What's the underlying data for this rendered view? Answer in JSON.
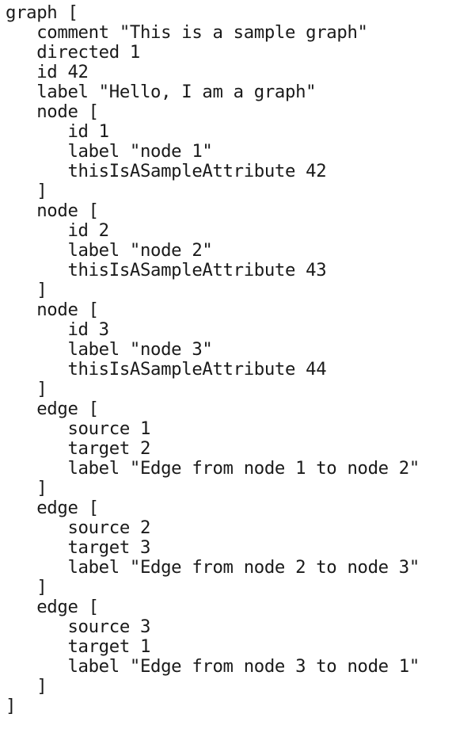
{
  "document": {
    "kind": "plain-text-code-listing",
    "language": "GML",
    "background_color": "#ffffff",
    "text_color": "#1a1a1a",
    "indent_unit": "   ",
    "line_count": 35
  },
  "listing": {
    "lines": [
      "graph [",
      "   comment \"This is a sample graph\"",
      "   directed 1",
      "   id 42",
      "   label \"Hello, I am a graph\"",
      "   node [",
      "      id 1",
      "      label \"node 1\"",
      "      thisIsASampleAttribute 42",
      "   ]",
      "   node [",
      "      id 2",
      "      label \"node 2\"",
      "      thisIsASampleAttribute 43",
      "   ]",
      "   node [",
      "      id 3",
      "      label \"node 3\"",
      "      thisIsASampleAttribute 44",
      "   ]",
      "   edge [",
      "      source 1",
      "      target 2",
      "      label \"Edge from node 1 to node 2\"",
      "   ]",
      "   edge [",
      "      source 2",
      "      target 3",
      "      label \"Edge from node 2 to node 3\"",
      "   ]",
      "   edge [",
      "      source 3",
      "      target 1",
      "      label \"Edge from node 3 to node 1\"",
      "   ]",
      "]"
    ]
  },
  "graph_model": {
    "comment": "This is a sample graph",
    "directed": 1,
    "id": 42,
    "label": "Hello, I am a graph",
    "nodes": [
      {
        "id": 1,
        "label": "node 1",
        "thisIsASampleAttribute": 42
      },
      {
        "id": 2,
        "label": "node 2",
        "thisIsASampleAttribute": 43
      },
      {
        "id": 3,
        "label": "node 3",
        "thisIsASampleAttribute": 44
      }
    ],
    "edges": [
      {
        "source": 1,
        "target": 2,
        "label": "Edge from node 1 to node 2"
      },
      {
        "source": 2,
        "target": 3,
        "label": "Edge from node 2 to node 3"
      },
      {
        "source": 3,
        "target": 1,
        "label": "Edge from node 3 to node 1"
      }
    ]
  }
}
